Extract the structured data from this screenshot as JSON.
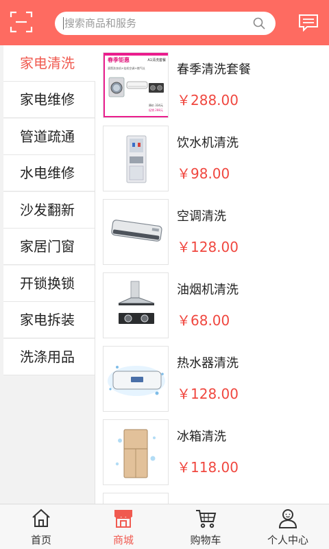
{
  "colors": {
    "accent": "#fe6b61",
    "price": "#f0473f",
    "active_text": "#f05a50"
  },
  "header": {
    "scan_icon": "scan-icon",
    "search_placeholder": "搜索商品和服务",
    "search_icon": "search-icon",
    "message_icon": "message-icon"
  },
  "sidebar": {
    "items": [
      {
        "label": "家电清洗",
        "active": true
      },
      {
        "label": "家电维修"
      },
      {
        "label": "管道疏通"
      },
      {
        "label": "水电维修"
      },
      {
        "label": "沙发翻新"
      },
      {
        "label": "家居门窗"
      },
      {
        "label": "开锁换锁"
      },
      {
        "label": "家电拆装"
      },
      {
        "label": "洗涤用品"
      }
    ]
  },
  "products": [
    {
      "name": "春季清洗套餐",
      "price": "￥288.00",
      "image": "spring-package-image",
      "banner": {
        "title": "春季钜惠",
        "tag": "A1清洗套餐",
        "subtitle": "滚筒洗衣机+挂机空调+燃气灶",
        "price_line": "原价 334元",
        "sale_line": "促销 288元"
      }
    },
    {
      "name": "饮水机清洗",
      "price": "￥98.00",
      "image": "water-dispenser-image"
    },
    {
      "name": "空调清洗",
      "price": "￥128.00",
      "image": "air-conditioner-image"
    },
    {
      "name": "油烟机清洗",
      "price": "￥68.00",
      "image": "range-hood-image"
    },
    {
      "name": "热水器清洗",
      "price": "￥128.00",
      "image": "water-heater-image"
    },
    {
      "name": "冰箱清洗",
      "price": "￥118.00",
      "image": "refrigerator-image"
    }
  ],
  "bottom_nav": [
    {
      "label": "首页",
      "icon": "home-icon"
    },
    {
      "label": "商城",
      "icon": "shop-icon",
      "active": true
    },
    {
      "label": "购物车",
      "icon": "cart-icon"
    },
    {
      "label": "个人中心",
      "icon": "user-icon"
    }
  ]
}
